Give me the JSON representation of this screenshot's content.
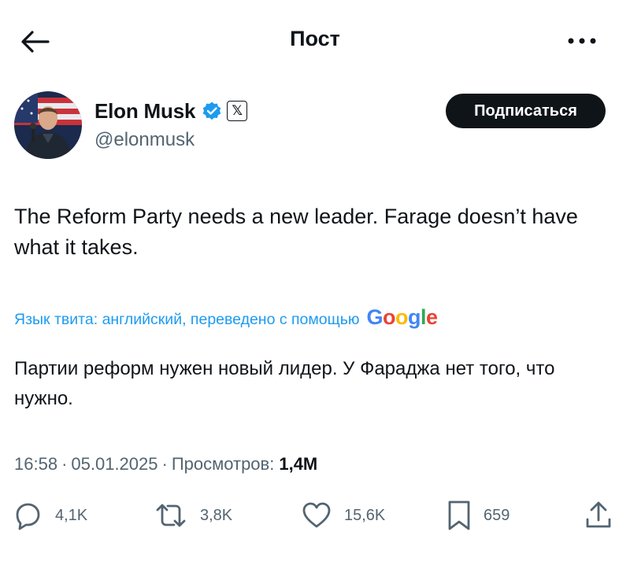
{
  "header": {
    "title": "Пост",
    "back_icon": "arrow-left-icon",
    "more_icon": "more-horizontal-icon"
  },
  "author": {
    "display_name": "Elon Musk",
    "handle": "@elonmusk",
    "verified_color": "#1d9bf0",
    "affiliate_badge": "𝕏",
    "follow_label": "Подписаться"
  },
  "tweet": {
    "text": "The Reform Party needs a new leader. Farage doesn’t have what it takes.",
    "translation_label": "Язык твита: английский, переведено с помощью",
    "translation_provider": "Google",
    "translated_text": "Партии реформ нужен новый лидер. У Фараджа нет того, что нужно.",
    "time": "16:58",
    "date": "05.01.2025",
    "views_label": "Просмотров:",
    "views_count": "1,4M"
  },
  "actions": {
    "replies": "4,1K",
    "reposts": "3,8K",
    "likes": "15,6K",
    "bookmarks": "659"
  },
  "colors": {
    "text": "#0f1419",
    "secondary": "#536471",
    "accent": "#1d9bf0"
  }
}
